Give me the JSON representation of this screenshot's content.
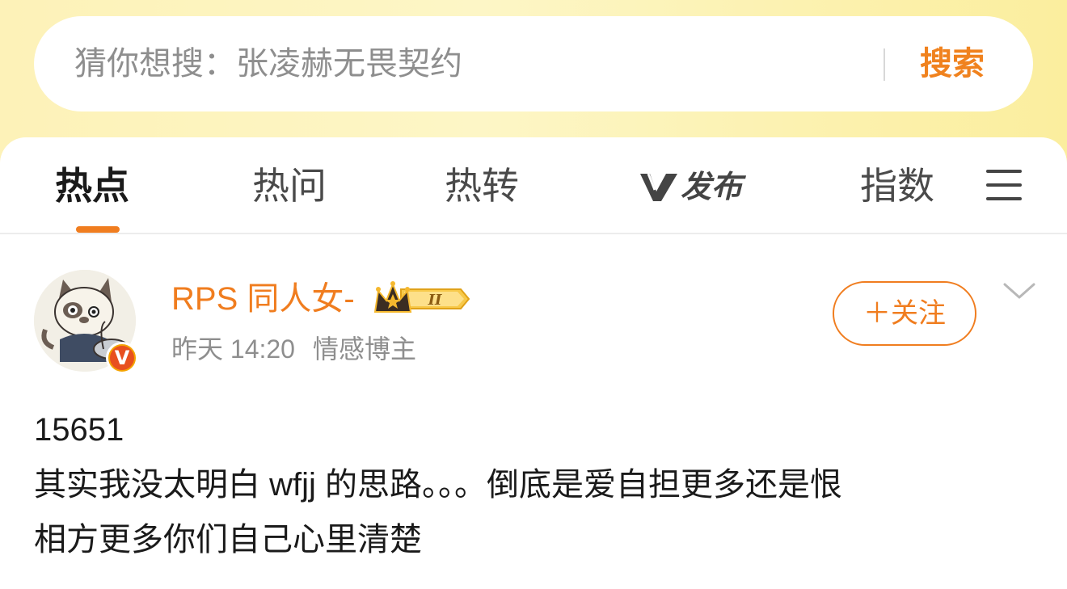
{
  "search": {
    "placeholder": "猜你想搜：张凌赫无畏契约",
    "button_label": "搜索"
  },
  "tabs": [
    {
      "label": "热点",
      "active": true
    },
    {
      "label": "热问",
      "active": false
    },
    {
      "label": "热转",
      "active": false
    },
    {
      "label": "发布",
      "active": false,
      "logo": "v-logo"
    },
    {
      "label": "指数",
      "active": false
    }
  ],
  "post": {
    "author": {
      "name": "RPS 同人女-",
      "level_badge": "II",
      "verified": true
    },
    "time": "昨天 14:20",
    "category": "情感博主",
    "follow_label": "＋关注",
    "lines": [
      "15651",
      "其实我没太明白 wfjj 的思路。。。倒底是爱自担更多还是恨",
      "相方更多你们自己心里清楚"
    ]
  },
  "colors": {
    "accent": "#f07d1f",
    "header_bg": "#fdf2b8"
  }
}
